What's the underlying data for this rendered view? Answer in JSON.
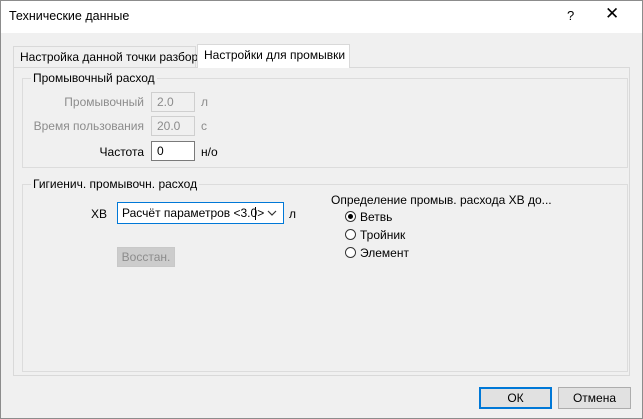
{
  "window": {
    "title": "Технические данные",
    "help": "?",
    "close": "✕"
  },
  "tabs": [
    {
      "label": "Настройка данной точки разбора"
    },
    {
      "label": "Настройки для промывки"
    }
  ],
  "flush_group": {
    "title": "Промывочный расход",
    "flush_label": "Промывочный",
    "flush_value": "2.0",
    "flush_unit": "л",
    "usage_label": "Время пользования",
    "usage_value": "20.0",
    "usage_unit": "с",
    "freq_label": "Частота",
    "freq_value": "0",
    "freq_unit": "н/о"
  },
  "hygiene_group": {
    "title": "Гигиенич. промывочн. расход",
    "xb_label": "ХВ",
    "combo_value": "Расчёт параметров <3.0>",
    "combo_unit": "л",
    "restore_label": "Восстан.",
    "def_label": "Определение промыв. расхода ХВ до...",
    "options": [
      {
        "label": "Ветвь",
        "checked": true
      },
      {
        "label": "Тройник",
        "checked": false
      },
      {
        "label": "Элемент",
        "checked": false
      }
    ]
  },
  "buttons": {
    "ok": "ОК",
    "cancel": "Отмена"
  },
  "colors": {
    "accent": "#0078d7",
    "background": "#f0f0f0"
  }
}
